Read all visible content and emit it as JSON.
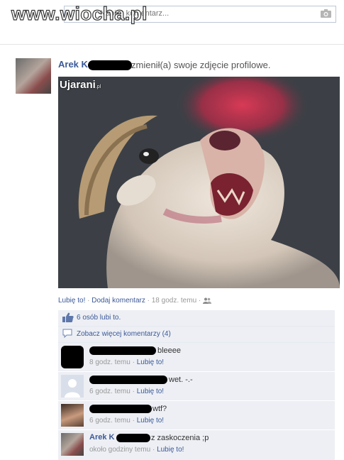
{
  "watermark": "www.wiocha.pl",
  "top_comment": {
    "placeholder": "Napisz komentarz..."
  },
  "post": {
    "author": "Arek K",
    "action": "zmienił(a) swoje zdjęcie profilowe.",
    "photo_caption": "Ujarani",
    "photo_caption_small": ".pl",
    "like_link": "Lubię to!",
    "comment_link": "Dodaj komentarz",
    "time": "18 godz. temu"
  },
  "likes_text": "6 osób lubi to.",
  "see_more_text": "Zobacz więcej komentarzy (4)",
  "comments": [
    {
      "text": "bleeee",
      "time": "8 godz. temu",
      "like": "Lubię to!"
    },
    {
      "text": "wet. -.-",
      "time": "6 godz. temu",
      "like": "Lubię to!"
    },
    {
      "text": "wtf?",
      "time": "6 godz. temu",
      "like": "Lubię to!"
    },
    {
      "author": "Arek K",
      "text": "z zaskoczenia ;p",
      "time": "około godziny temu",
      "like": "Lubię to!"
    }
  ],
  "colors": {
    "link": "#3b5998",
    "ufi_bg": "#edeff4"
  }
}
